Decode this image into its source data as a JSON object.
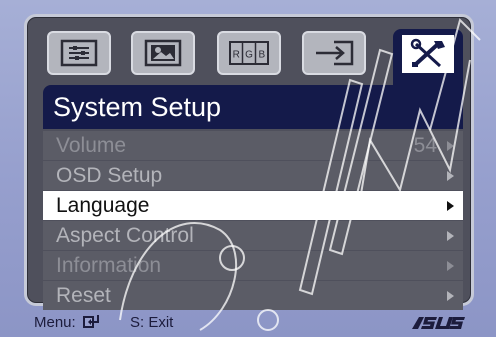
{
  "osd": {
    "title": "System Setup",
    "tabs": [
      {
        "icon": "splendid-icon",
        "active": false
      },
      {
        "icon": "color-image-icon",
        "active": false
      },
      {
        "icon": "rgb-icon",
        "active": false
      },
      {
        "icon": "input-select-icon",
        "active": false
      },
      {
        "icon": "system-setup-tools-icon",
        "active": true
      }
    ],
    "items": [
      {
        "label": "Volume",
        "value": "54",
        "state": "dim"
      },
      {
        "label": "OSD Setup",
        "value": "",
        "state": "normal"
      },
      {
        "label": "Language",
        "value": "",
        "state": "selected"
      },
      {
        "label": "Aspect Control",
        "value": "",
        "state": "normal"
      },
      {
        "label": "Information",
        "value": "",
        "state": "dim"
      },
      {
        "label": "Reset",
        "value": "",
        "state": "normal"
      }
    ],
    "rgb_letters": [
      "R",
      "G",
      "B"
    ]
  },
  "footer": {
    "menu_label": "Menu:",
    "exit_label": "S: Exit",
    "brand": "ASUS"
  },
  "colors": {
    "title_bar": "#141a4a",
    "menu_item": "#5b5c66",
    "selected_item": "#ffffff",
    "bezel": "#97a0ce"
  }
}
